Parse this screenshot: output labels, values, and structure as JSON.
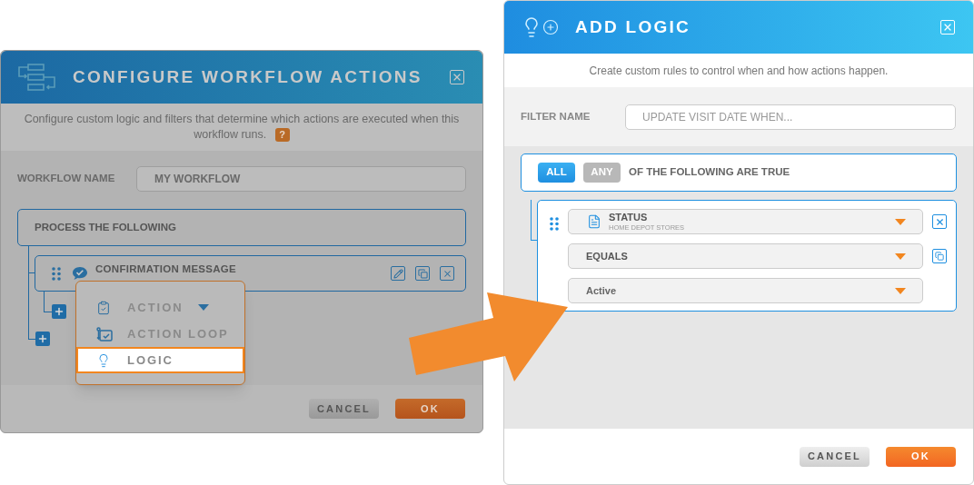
{
  "workflow_dialog": {
    "title": "CONFIGURE WORKFLOW ACTIONS",
    "description": "Configure custom logic and filters that determine which actions are executed when this workflow runs.",
    "help": "?",
    "name_label": "WORKFLOW NAME",
    "name_value": "MY WORKFLOW",
    "group_label": "PROCESS THE FOLLOWING",
    "action_label": "CONFIRMATION MESSAGE",
    "menu": [
      {
        "kind": "action",
        "label": "ACTION",
        "submenu": true,
        "selected": false
      },
      {
        "kind": "loop",
        "label": "ACTION LOOP",
        "submenu": false,
        "selected": false
      },
      {
        "kind": "logic",
        "label": "LOGIC",
        "submenu": false,
        "selected": true
      }
    ],
    "buttons": [
      {
        "kind": "secondary",
        "label": "CANCEL"
      },
      {
        "kind": "primary",
        "label": "OK"
      }
    ]
  },
  "logic_dialog": {
    "title": "ADD LOGIC",
    "description": "Create custom rules to control when and how actions happen.",
    "filter_label": "FILTER NAME",
    "filter_placeholder": "UPDATE VISIT DATE WHEN...",
    "match": [
      {
        "label": "ALL",
        "selected": true
      },
      {
        "label": "ANY",
        "selected": false
      }
    ],
    "match_suffix": "OF THE FOLLOWING ARE TRUE",
    "condition": {
      "field": "STATUS",
      "source": "HOME DEPOT STORES",
      "operator": "EQUALS",
      "value": "Active"
    },
    "buttons": [
      {
        "kind": "secondary",
        "label": "CANCEL"
      },
      {
        "kind": "primary",
        "label": "OK"
      }
    ]
  }
}
